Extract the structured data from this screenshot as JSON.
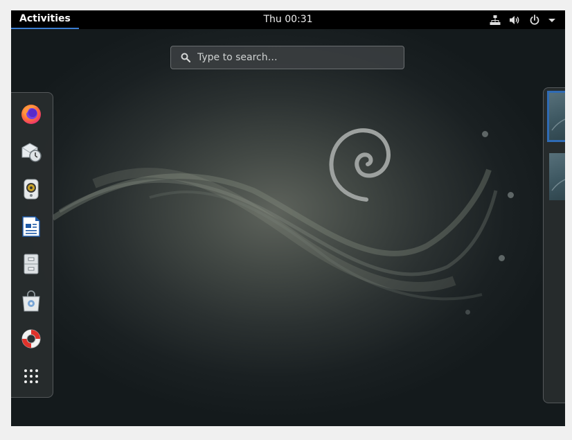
{
  "top_bar": {
    "activities_label": "Activities",
    "clock": "Thu 00:31",
    "status_icons": [
      "network-wired-icon",
      "volume-icon",
      "power-icon",
      "menu-arrow-icon"
    ]
  },
  "search": {
    "placeholder": "Type to search…"
  },
  "dash": {
    "items": [
      {
        "name": "Firefox",
        "icon": "firefox-icon"
      },
      {
        "name": "Evolution",
        "icon": "mail-clock-icon"
      },
      {
        "name": "Rhythmbox",
        "icon": "speaker-icon"
      },
      {
        "name": "LibreOffice Writer",
        "icon": "document-writer-icon"
      },
      {
        "name": "Files",
        "icon": "file-cabinet-icon"
      },
      {
        "name": "Software",
        "icon": "shopping-bag-icon"
      },
      {
        "name": "Help",
        "icon": "lifebuoy-icon"
      },
      {
        "name": "Show Applications",
        "icon": "app-grid-icon"
      }
    ]
  },
  "workspaces": {
    "count": 2,
    "active": 1
  },
  "colors": {
    "topbar_bg": "#000000",
    "accent": "#3b7ed3",
    "firefox_orange": "#ff7139",
    "writer_blue": "#1e5aa8",
    "lifebuoy_red": "#e0322b"
  }
}
